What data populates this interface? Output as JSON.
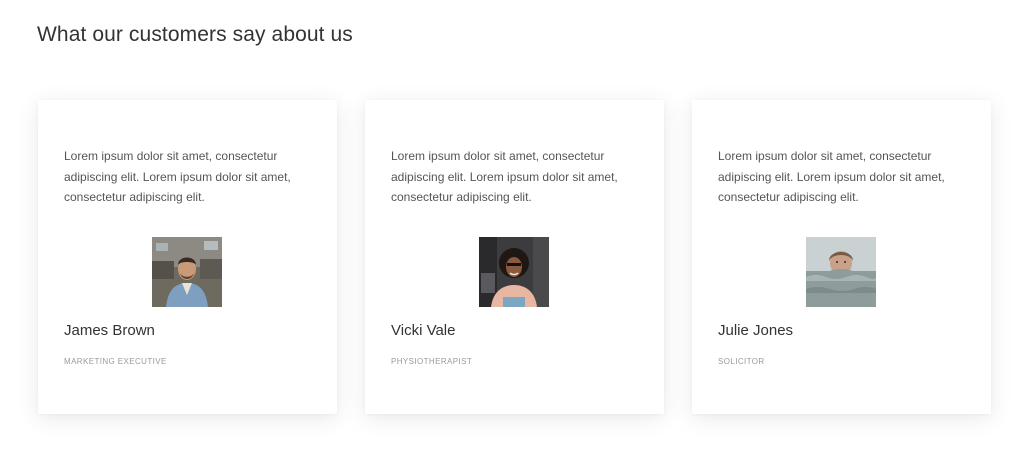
{
  "section": {
    "title": "What our customers say about us"
  },
  "testimonials": [
    {
      "quote": "Lorem ipsum dolor sit amet, consectetur adipiscing elit. Lorem ipsum dolor sit amet, consectetur adipiscing elit.",
      "name": "James Brown",
      "role": "MARKETING EXECUTIVE",
      "photo_icon": "person-photo-icon"
    },
    {
      "quote": "Lorem ipsum dolor sit amet, consectetur adipiscing elit. Lorem ipsum dolor sit amet, consectetur adipiscing elit.",
      "name": "Vicki Vale",
      "role": "PHYSIOTHERAPIST",
      "photo_icon": "person-photo-icon"
    },
    {
      "quote": "Lorem ipsum dolor sit amet, consectetur adipiscing elit. Lorem ipsum dolor sit amet, consectetur adipiscing elit.",
      "name": "Julie Jones",
      "role": "SOLICITOR",
      "photo_icon": "person-photo-icon"
    }
  ],
  "colors": {
    "title_text": "#333333",
    "body_text": "#555555",
    "role_text": "#9a9a9a",
    "card_background": "#ffffff"
  }
}
